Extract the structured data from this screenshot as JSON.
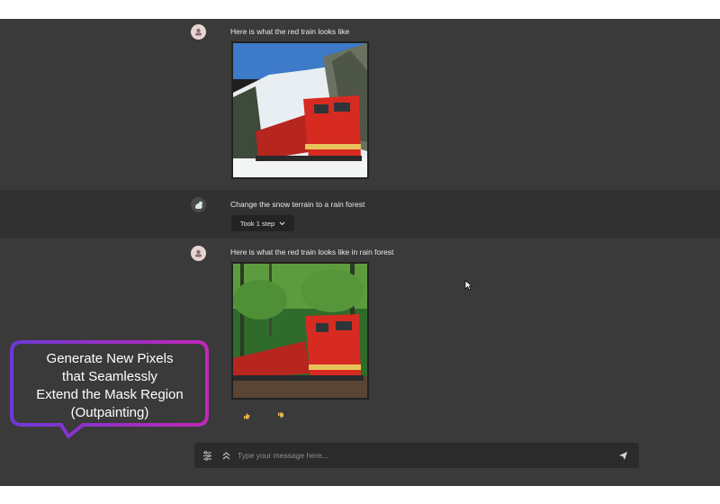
{
  "messages": [
    {
      "role": "bot",
      "text": "Here is what the red train looks like",
      "image": "red train in snowy terrain"
    },
    {
      "role": "user",
      "text": "Change the snow terrain to a rain forest",
      "step_label": "Took 1 step"
    },
    {
      "role": "bot",
      "text": "Here is what the red train looks like in rain forest",
      "image": "red train in rain forest"
    }
  ],
  "composer": {
    "placeholder": "Type your message here...",
    "value": ""
  },
  "callout": {
    "line1": "Generate New Pixels",
    "line2": "that Seamlessly",
    "line3": "Extend the Mask Region",
    "line4": "(Outpainting)"
  },
  "icons": {
    "bot_avatar": "bot-avatar-icon",
    "user_avatar": "user-avatar-icon",
    "chevron": "chevron-down-icon",
    "thumbs_up": "thumbs-up-icon",
    "thumbs_down": "thumbs-down-icon",
    "settings": "sliders-icon",
    "expand": "chevrons-up-icon",
    "send": "send-icon"
  },
  "colors": {
    "background": "#3a3a3a",
    "user_row": "#313131",
    "callout_start": "#6d39d6",
    "callout_end": "#c227b8"
  }
}
